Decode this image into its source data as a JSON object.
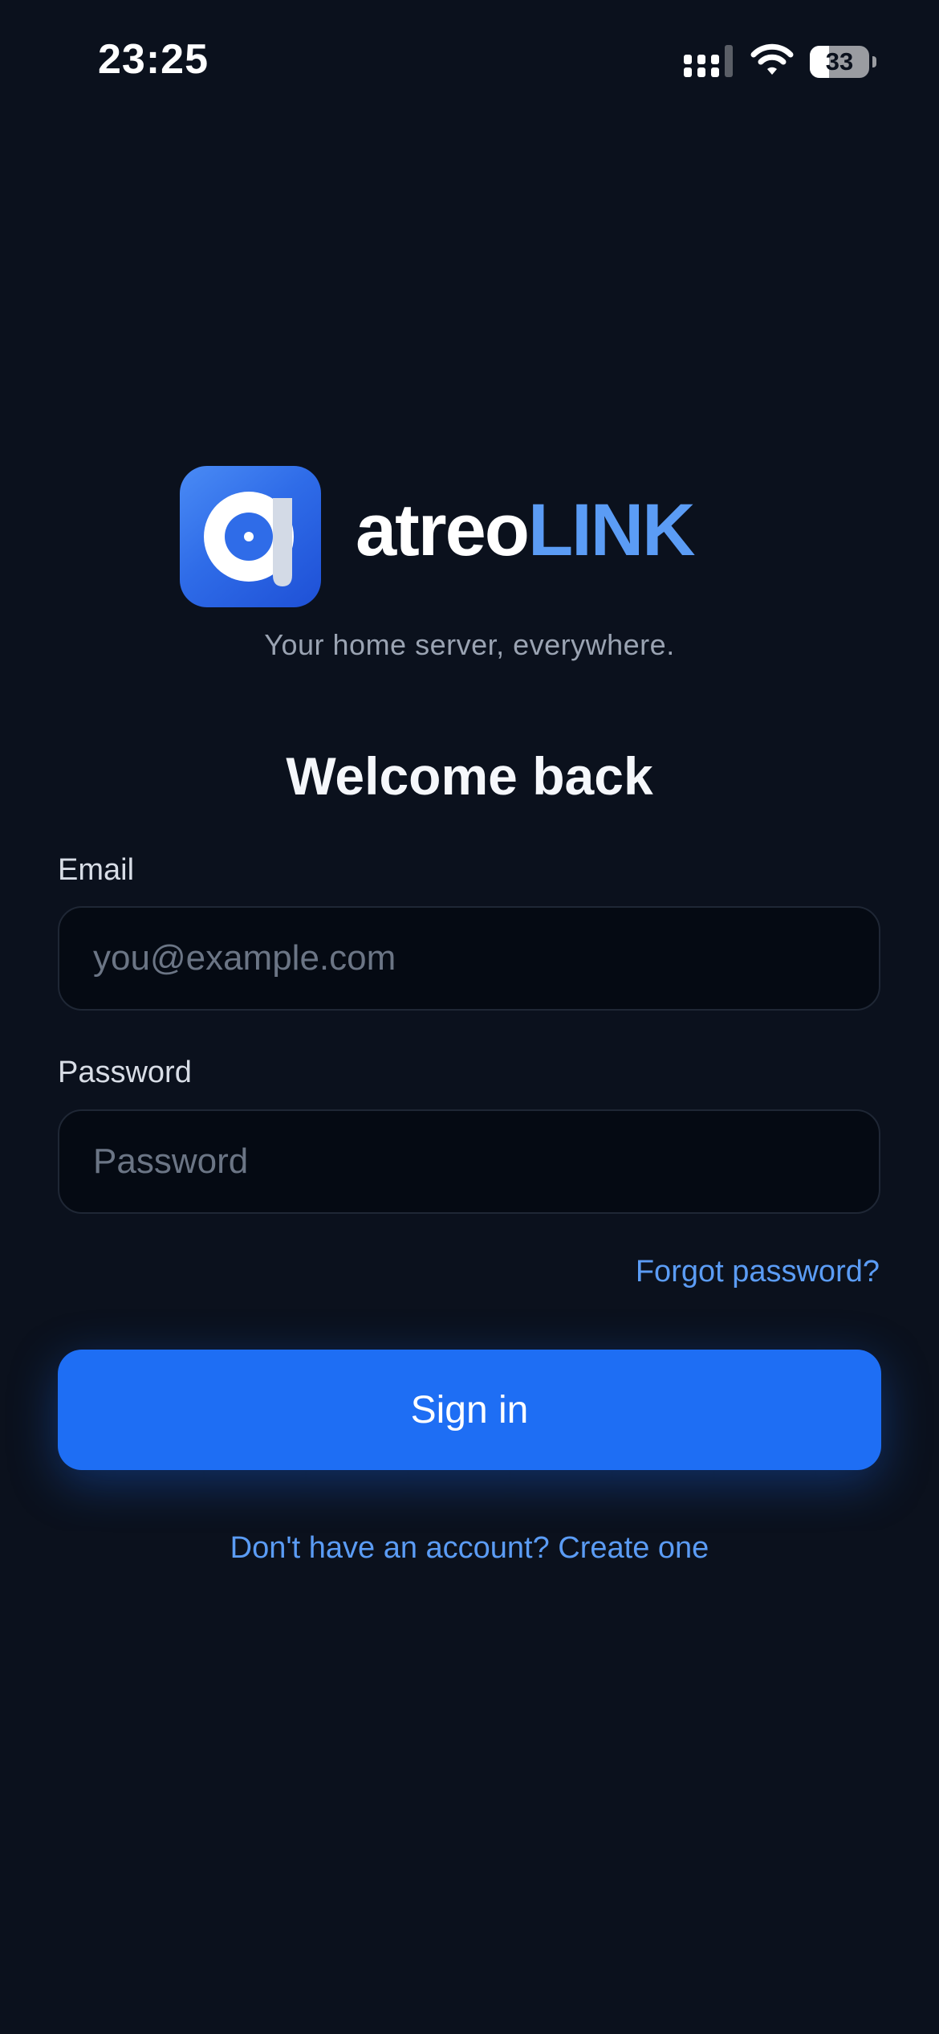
{
  "status_bar": {
    "time": "23:25",
    "battery_level": "33",
    "battery_fraction": 0.33,
    "signal_icon": "cellular-signal-icon",
    "wifi_icon": "wifi-icon"
  },
  "brand": {
    "logo_icon": "atreolink-logo-icon",
    "name_part1": "atreo",
    "name_part2": "LINK",
    "tagline": "Your home server, everywhere."
  },
  "form": {
    "title": "Welcome back",
    "email_label": "Email",
    "email_placeholder": "you@example.com",
    "password_label": "Password",
    "password_placeholder": "Password",
    "forgot_password": "Forgot password?",
    "submit_label": "Sign in",
    "create_account": "Don't have an account? Create one"
  },
  "colors": {
    "background": "#0b111d",
    "accent": "#1e6ef4",
    "link": "#5b9cf5",
    "input_background": "#050a13"
  }
}
